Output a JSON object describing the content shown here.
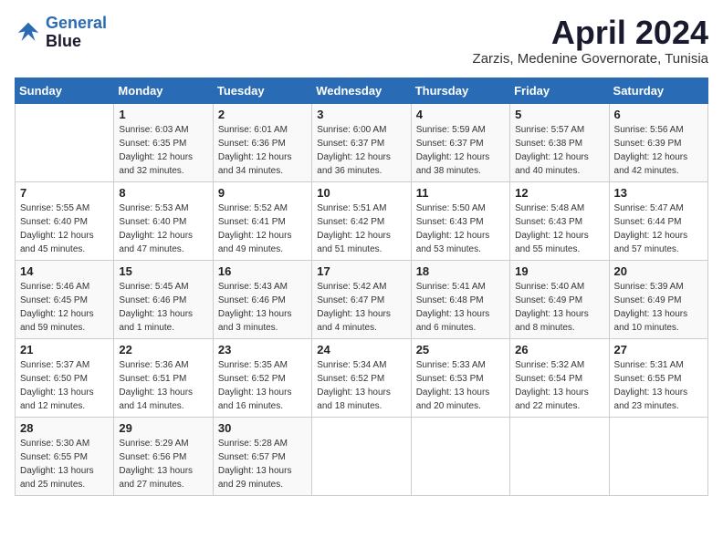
{
  "header": {
    "logo_line1": "General",
    "logo_line2": "Blue",
    "month_title": "April 2024",
    "subtitle": "Zarzis, Medenine Governorate, Tunisia"
  },
  "columns": [
    "Sunday",
    "Monday",
    "Tuesday",
    "Wednesday",
    "Thursday",
    "Friday",
    "Saturday"
  ],
  "weeks": [
    [
      {
        "day": "",
        "info": ""
      },
      {
        "day": "1",
        "info": "Sunrise: 6:03 AM\nSunset: 6:35 PM\nDaylight: 12 hours\nand 32 minutes."
      },
      {
        "day": "2",
        "info": "Sunrise: 6:01 AM\nSunset: 6:36 PM\nDaylight: 12 hours\nand 34 minutes."
      },
      {
        "day": "3",
        "info": "Sunrise: 6:00 AM\nSunset: 6:37 PM\nDaylight: 12 hours\nand 36 minutes."
      },
      {
        "day": "4",
        "info": "Sunrise: 5:59 AM\nSunset: 6:37 PM\nDaylight: 12 hours\nand 38 minutes."
      },
      {
        "day": "5",
        "info": "Sunrise: 5:57 AM\nSunset: 6:38 PM\nDaylight: 12 hours\nand 40 minutes."
      },
      {
        "day": "6",
        "info": "Sunrise: 5:56 AM\nSunset: 6:39 PM\nDaylight: 12 hours\nand 42 minutes."
      }
    ],
    [
      {
        "day": "7",
        "info": "Sunrise: 5:55 AM\nSunset: 6:40 PM\nDaylight: 12 hours\nand 45 minutes."
      },
      {
        "day": "8",
        "info": "Sunrise: 5:53 AM\nSunset: 6:40 PM\nDaylight: 12 hours\nand 47 minutes."
      },
      {
        "day": "9",
        "info": "Sunrise: 5:52 AM\nSunset: 6:41 PM\nDaylight: 12 hours\nand 49 minutes."
      },
      {
        "day": "10",
        "info": "Sunrise: 5:51 AM\nSunset: 6:42 PM\nDaylight: 12 hours\nand 51 minutes."
      },
      {
        "day": "11",
        "info": "Sunrise: 5:50 AM\nSunset: 6:43 PM\nDaylight: 12 hours\nand 53 minutes."
      },
      {
        "day": "12",
        "info": "Sunrise: 5:48 AM\nSunset: 6:43 PM\nDaylight: 12 hours\nand 55 minutes."
      },
      {
        "day": "13",
        "info": "Sunrise: 5:47 AM\nSunset: 6:44 PM\nDaylight: 12 hours\nand 57 minutes."
      }
    ],
    [
      {
        "day": "14",
        "info": "Sunrise: 5:46 AM\nSunset: 6:45 PM\nDaylight: 12 hours\nand 59 minutes."
      },
      {
        "day": "15",
        "info": "Sunrise: 5:45 AM\nSunset: 6:46 PM\nDaylight: 13 hours\nand 1 minute."
      },
      {
        "day": "16",
        "info": "Sunrise: 5:43 AM\nSunset: 6:46 PM\nDaylight: 13 hours\nand 3 minutes."
      },
      {
        "day": "17",
        "info": "Sunrise: 5:42 AM\nSunset: 6:47 PM\nDaylight: 13 hours\nand 4 minutes."
      },
      {
        "day": "18",
        "info": "Sunrise: 5:41 AM\nSunset: 6:48 PM\nDaylight: 13 hours\nand 6 minutes."
      },
      {
        "day": "19",
        "info": "Sunrise: 5:40 AM\nSunset: 6:49 PM\nDaylight: 13 hours\nand 8 minutes."
      },
      {
        "day": "20",
        "info": "Sunrise: 5:39 AM\nSunset: 6:49 PM\nDaylight: 13 hours\nand 10 minutes."
      }
    ],
    [
      {
        "day": "21",
        "info": "Sunrise: 5:37 AM\nSunset: 6:50 PM\nDaylight: 13 hours\nand 12 minutes."
      },
      {
        "day": "22",
        "info": "Sunrise: 5:36 AM\nSunset: 6:51 PM\nDaylight: 13 hours\nand 14 minutes."
      },
      {
        "day": "23",
        "info": "Sunrise: 5:35 AM\nSunset: 6:52 PM\nDaylight: 13 hours\nand 16 minutes."
      },
      {
        "day": "24",
        "info": "Sunrise: 5:34 AM\nSunset: 6:52 PM\nDaylight: 13 hours\nand 18 minutes."
      },
      {
        "day": "25",
        "info": "Sunrise: 5:33 AM\nSunset: 6:53 PM\nDaylight: 13 hours\nand 20 minutes."
      },
      {
        "day": "26",
        "info": "Sunrise: 5:32 AM\nSunset: 6:54 PM\nDaylight: 13 hours\nand 22 minutes."
      },
      {
        "day": "27",
        "info": "Sunrise: 5:31 AM\nSunset: 6:55 PM\nDaylight: 13 hours\nand 23 minutes."
      }
    ],
    [
      {
        "day": "28",
        "info": "Sunrise: 5:30 AM\nSunset: 6:55 PM\nDaylight: 13 hours\nand 25 minutes."
      },
      {
        "day": "29",
        "info": "Sunrise: 5:29 AM\nSunset: 6:56 PM\nDaylight: 13 hours\nand 27 minutes."
      },
      {
        "day": "30",
        "info": "Sunrise: 5:28 AM\nSunset: 6:57 PM\nDaylight: 13 hours\nand 29 minutes."
      },
      {
        "day": "",
        "info": ""
      },
      {
        "day": "",
        "info": ""
      },
      {
        "day": "",
        "info": ""
      },
      {
        "day": "",
        "info": ""
      }
    ]
  ]
}
